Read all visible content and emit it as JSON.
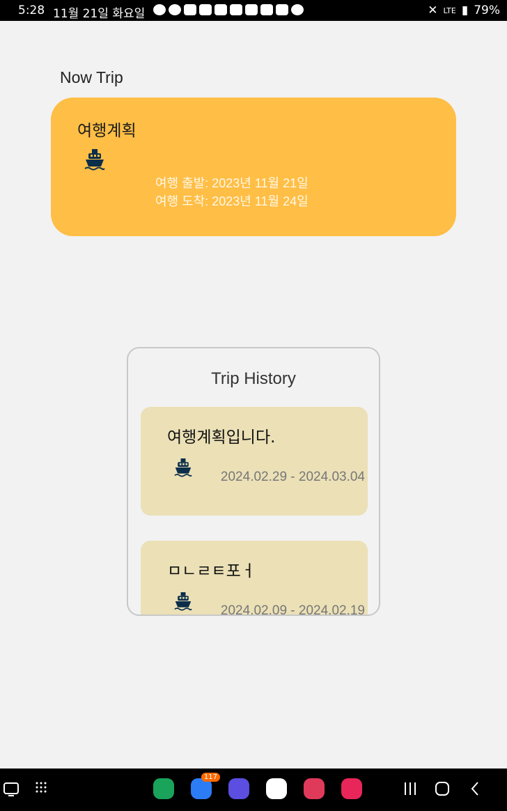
{
  "status_bar": {
    "time": "5:28",
    "date": "11월 21일 화요일",
    "network": "LTE",
    "battery": "79%"
  },
  "now_trip": {
    "section_title": "Now Trip",
    "title": "여행계획",
    "icon": "ship-icon",
    "departure": "여행 출발: 2023년 11월 21일",
    "arrival": "여행 도착: 2023년 11월 24일",
    "card_color": "#ffbe45"
  },
  "trip_history": {
    "title": "Trip History",
    "items": [
      {
        "title": "여행계획입니다.",
        "dates": "2024.02.29 - 2024.03.04",
        "icon": "ship-icon"
      },
      {
        "title": "ㅁㄴㄹㅌ포ㅓ",
        "dates": "2024.02.09 - 2024.02.19",
        "icon": "ship-icon"
      }
    ],
    "item_color": "#ebe0b6"
  },
  "nav_bar": {
    "badge_count": "117",
    "apps": [
      "kakaotalk-icon",
      "messages-icon",
      "internet-icon",
      "play-store-icon",
      "camera-icon",
      "gallery-icon"
    ]
  }
}
